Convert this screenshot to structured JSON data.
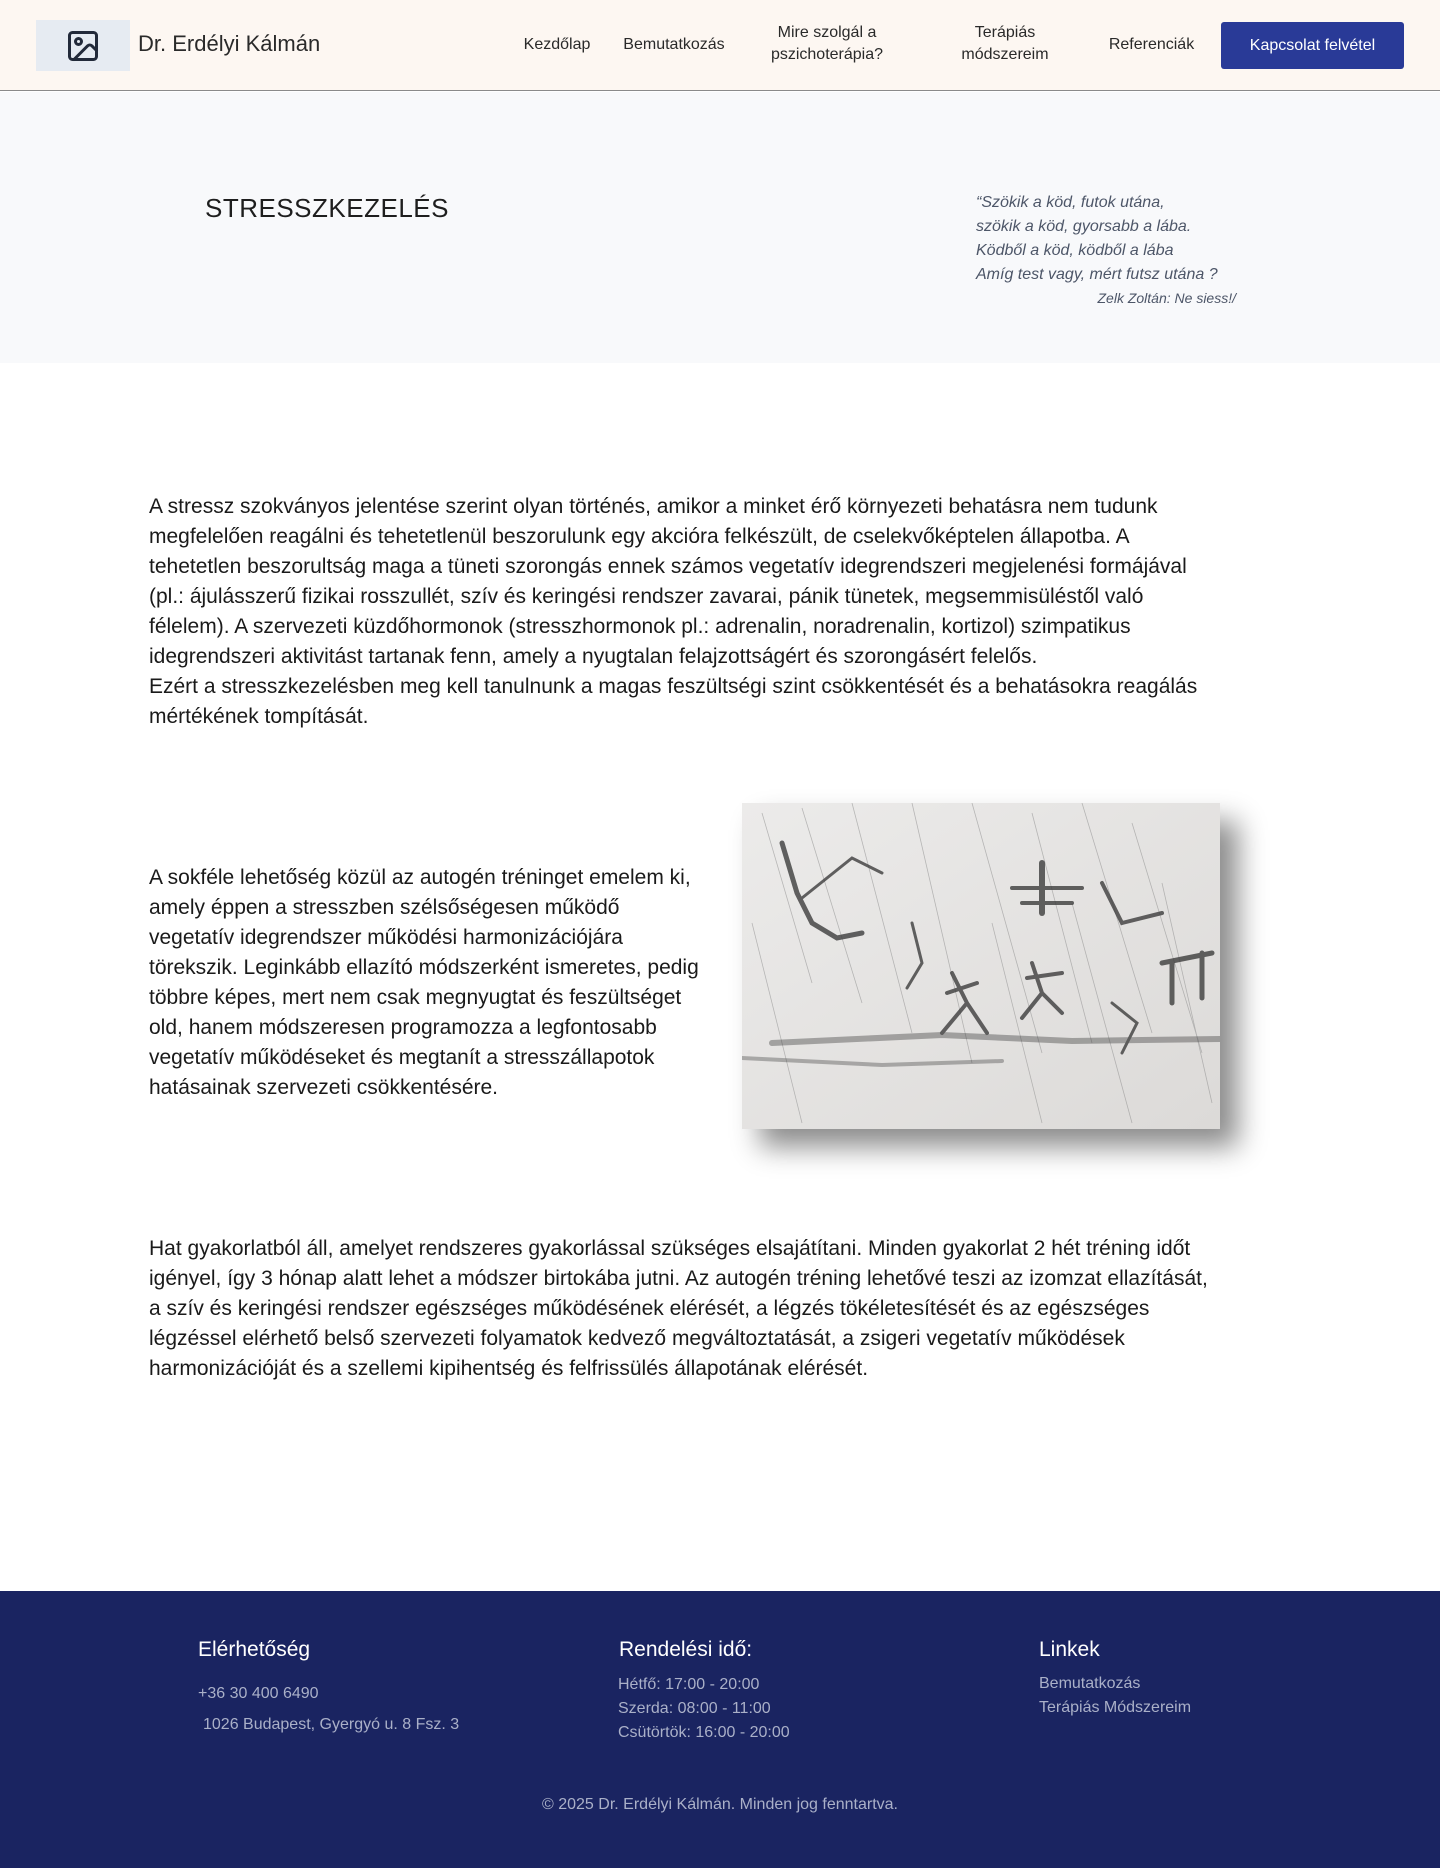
{
  "header": {
    "site_name": "Dr. Erdélyi Kálmán",
    "logo_icon": "image-placeholder-icon",
    "nav": {
      "home": "Kezdőlap",
      "intro": "Bemutatkozás",
      "purpose_line1": "Mire szolgál a",
      "purpose_line2": "pszichoterápia?",
      "methods_line1": "Terápiás",
      "methods_line2": "módszereim",
      "references": "Referenciák"
    },
    "cta_label": "Kapcsolat felvétel"
  },
  "hero": {
    "title": "STRESSZKEZELÉS",
    "quote_lines": [
      "“Szökik a köd, futok utána,",
      "szökik a köd, gyorsabb a lába.",
      "Ködből a köd, ködből a lába",
      "Amíg test vagy, mért futsz utána ?"
    ],
    "quote_author": "Zelk Zoltán: Ne siess!/"
  },
  "content": {
    "para1_lines": [
      "A stressz szokványos jelentése szerint olyan történés, amikor a minket érő környezeti behatásra nem tudunk",
      "megfelelően reagálni és tehetetlenül beszorulunk egy akcióra felkészült, de cselekvőképtelen állapotba. A",
      "tehetetlen beszorultság maga a tüneti szorongás ennek számos vegetatív idegrendszeri megjelenési formájával",
      "(pl.: ájulásszerű fizikai rosszullét, szív és keringési rendszer zavarai, pánik tünetek, megsemmisüléstől való",
      "félelem). A szervezeti küzdőhormonok (stresszhormonok pl.: adrenalin, noradrenalin, kortizol) szimpatikus",
      "idegrendszeri aktivitást tartanak fenn, amely a nyugtalan felajzottságért és szorongásért felelős.",
      "Ezért a stresszkezelésben meg kell tanulnunk a magas feszültségi szint csökkentését és a behatásokra reagálás",
      "mértékének tompítását."
    ],
    "para2_lines": [
      "A sokféle lehetőség közül az autogén tréninget emelem ki,",
      "amely éppen a stresszben szélsőségesen működő",
      "vegetatív idegrendszer működési harmonizációjára",
      "törekszik. Leginkább ellazító módszerként ismeretes, pedig",
      "többre képes, mert nem csak megnyugtat és feszültséget",
      "old, hanem módszeresen programozza a legfontosabb",
      "vegetatív működéseket és megtanít a stresszállapotok",
      "hatásainak szervezeti csökkentésére."
    ],
    "para3_lines": [
      "Hat gyakorlatból áll, amelyet rendszeres gyakorlással szükséges elsajátítani. Minden gyakorlat 2 hét tréning időt",
      "igényel, így 3 hónap alatt lehet a módszer birtokába jutni. Az autogén tréning lehetővé teszi az izomzat ellazítását,",
      "a szív és keringési rendszer egészséges működésének elérését, a légzés tökéletesítését és az egészséges",
      "légzéssel elérhető belső szervezeti folyamatok kedvező megváltoztatását, a zsigeri vegetatív működések",
      "harmonizációját és a szellemi kipihentség és felfrissülés állapotának elérését."
    ]
  },
  "footer": {
    "contact": {
      "heading": "Elérhetőség",
      "phone": "+36 30 400 6490",
      "address": "1026 Budapest, Gyergyó u. 8 Fsz. 3"
    },
    "hours": {
      "heading": "Rendelési idő:",
      "lines": [
        "Hétfő: 17:00 - 20:00",
        "Szerda: 08:00 - 11:00",
        "Csütörtök: 16:00 - 20:00"
      ]
    },
    "links": {
      "heading": "Linkek",
      "items": [
        "Bemutatkozás",
        "Terápiás Módszereim"
      ]
    },
    "copyright": "© 2025 Dr. Erdélyi Kálmán. Minden jog fenntartva."
  },
  "colors": {
    "header_bg": "#fdf7f2",
    "accent_button": "#293a97",
    "footer_bg": "#1a2461",
    "hero_bg": "#f8f9fb"
  }
}
